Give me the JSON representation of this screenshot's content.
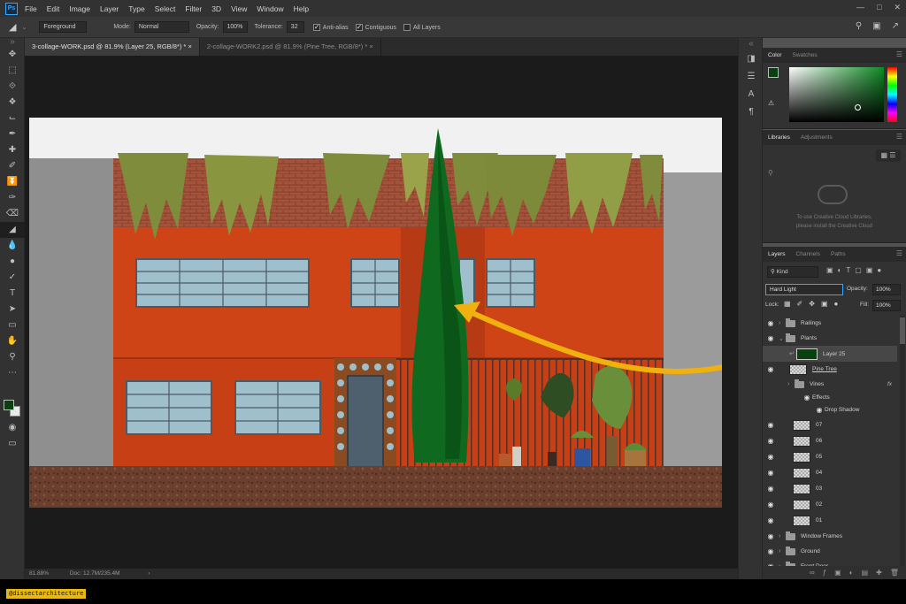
{
  "menu": [
    "File",
    "Edit",
    "Image",
    "Layer",
    "Type",
    "Select",
    "Filter",
    "3D",
    "View",
    "Window",
    "Help"
  ],
  "app_logo": "Ps",
  "options": {
    "fill_source": "Foreground",
    "mode_label": "Mode:",
    "mode_value": "Normal",
    "opacity_label": "Opacity:",
    "opacity_value": "100%",
    "tolerance_label": "Tolerance:",
    "tolerance_value": "32",
    "antialias": "Anti-alias",
    "contiguous": "Contiguous",
    "all_layers": "All Layers"
  },
  "tabs": [
    {
      "label": "3-collage-WORK.psd @ 81.9% (Layer 25, RGB/8*) *",
      "active": true
    },
    {
      "label": "2-collage-WORK2.psd @ 81.9% (Pine Tree, RGB/8*) *",
      "active": false
    }
  ],
  "status": {
    "zoom": "81.88%",
    "doc": "Doc: 12.7M/235.4M"
  },
  "color_panel": {
    "tabs": [
      "Color",
      "Swatches"
    ],
    "foreground": "#08400f"
  },
  "libraries_panel": {
    "tabs": [
      "Libraries",
      "Adjustments"
    ],
    "message_line1": "To use Creative Cloud Libraries,",
    "message_line2": "please install the Creative Cloud"
  },
  "layers_panel": {
    "tabs": [
      "Layers",
      "Channels",
      "Paths"
    ],
    "filter_kind": "Kind",
    "blend_mode": "Hard Light",
    "opacity_label": "Opacity:",
    "opacity_value": "100%",
    "lock_label": "Lock:",
    "fill_label": "Fill:",
    "fill_value": "100%",
    "layers": [
      {
        "name": "Railings",
        "type": "group"
      },
      {
        "name": "Plants",
        "type": "group-open"
      },
      {
        "name": "Layer 25",
        "type": "layer-green",
        "selected": true
      },
      {
        "name": "Pine Tree",
        "type": "layer"
      },
      {
        "name": "Vines",
        "type": "group-fx"
      },
      {
        "name": "Effects",
        "type": "effects"
      },
      {
        "name": "Drop Shadow",
        "type": "effect"
      },
      {
        "name": "07",
        "type": "layer"
      },
      {
        "name": "06",
        "type": "layer"
      },
      {
        "name": "05",
        "type": "layer"
      },
      {
        "name": "04",
        "type": "layer"
      },
      {
        "name": "03",
        "type": "layer"
      },
      {
        "name": "02",
        "type": "layer"
      },
      {
        "name": "01",
        "type": "layer"
      },
      {
        "name": "Window Frames",
        "type": "group"
      },
      {
        "name": "Ground",
        "type": "group"
      },
      {
        "name": "Front Door",
        "type": "group"
      }
    ]
  },
  "fx_label": "fx",
  "watermark": "@dissectarchitecture",
  "colors": {
    "accent_arrow": "#f0b10f",
    "facade": "#cf4416",
    "brick": "#a04a32"
  }
}
